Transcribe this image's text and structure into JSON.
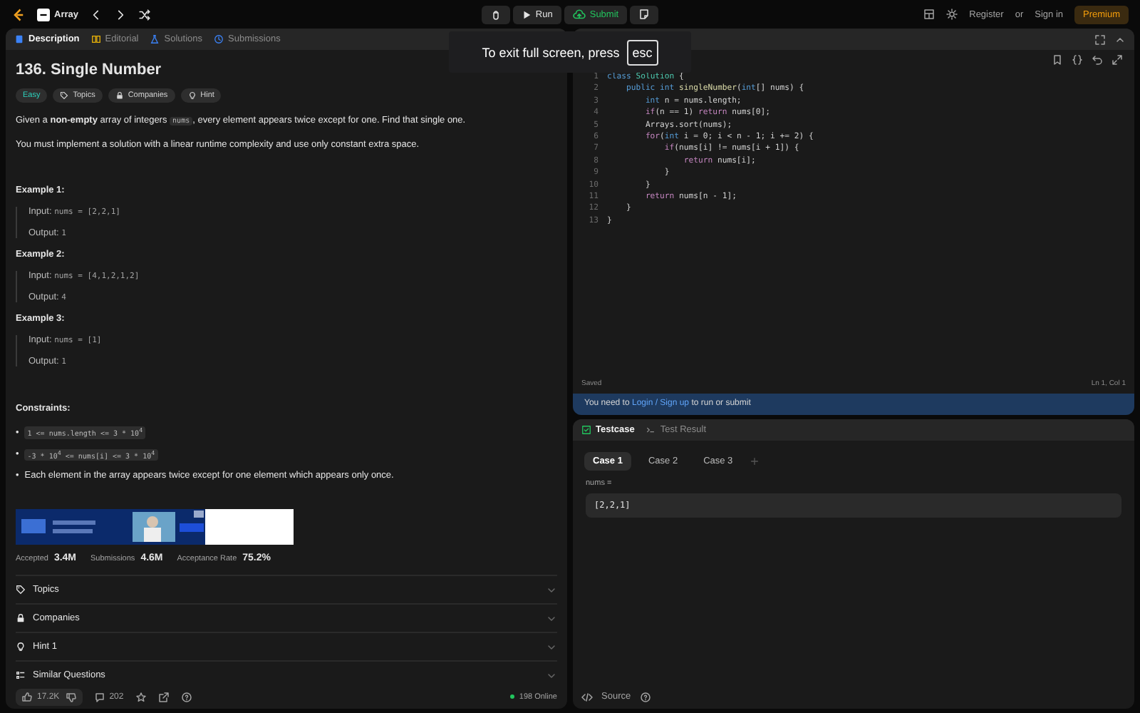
{
  "topbar": {
    "problem_list": "Array",
    "run": "Run",
    "submit": "Submit",
    "register": "Register",
    "or": "or",
    "sign_in": "Sign in",
    "premium": "Premium"
  },
  "left_tabs": [
    {
      "label": "Description",
      "selected": true
    },
    {
      "label": "Editorial",
      "selected": false
    },
    {
      "label": "Solutions",
      "selected": false
    },
    {
      "label": "Submissions",
      "selected": false
    }
  ],
  "problem": {
    "title": "136. Single Number",
    "difficulty": "Easy",
    "tags": [
      {
        "label": "Topics"
      },
      {
        "label": "Companies"
      },
      {
        "label": "Hint"
      }
    ],
    "intro": {
      "before": "Given a **non-empty** array of integers",
      "code": "nums",
      "after": ", every element appears twice except for one. Find that single one."
    },
    "note": "You must implement a solution with a linear runtime complexity and use only constant extra space.",
    "examples": [
      {
        "title": "Example 1:",
        "input_label": "Input:",
        "input": "nums = [2,2,1]",
        "output_label": "Output:",
        "output": "1"
      },
      {
        "title": "Example 2:",
        "input_label": "Input:",
        "input": "nums = [4,1,2,1,2]",
        "output_label": "Output:",
        "output": "4"
      },
      {
        "title": "Example 3:",
        "input_label": "Input:",
        "input": "nums = [1]",
        "output_label": "Output:",
        "output": "1"
      }
    ],
    "constraints_title": "Constraints:",
    "constraints": [
      {
        "kind": "code",
        "bullet": "•",
        "text": "1 <= nums.length <= 3 * 10$^{4}$"
      },
      {
        "kind": "code",
        "bullet": "•",
        "text": "-3 * 10$^{4}$ <= nums[i] <= 3 * 10$^{4}$"
      },
      {
        "kind": "text",
        "bullet": "•",
        "text": "Each element in the array appears twice except for one element which appears only once."
      }
    ],
    "stats": [
      {
        "label": "Accepted",
        "value": "3.4M"
      },
      {
        "label": "Submissions",
        "value": "4.6M"
      },
      {
        "label": "Acceptance Rate",
        "value": "75.2%"
      }
    ],
    "sections": [
      {
        "label": "Topics"
      },
      {
        "label": "Companies"
      },
      {
        "label": "Hint 1"
      },
      {
        "label": "Similar Questions"
      }
    ],
    "footer": {
      "likes": "17.2K",
      "comments": "202",
      "online": "198 Online"
    }
  },
  "code_panel": {
    "saved": "Saved",
    "cursor": "Ln 1, Col 1",
    "lines": [
      [
        {
          "kind": "keyword",
          "t": "class"
        },
        {
          "kind": "type",
          "t": " Solution"
        },
        {
          "kind": "plain",
          "t": " {"
        }
      ],
      [
        {
          "kind": "keyword",
          "t": "    public int"
        },
        {
          "kind": "function",
          "t": " singleNumber"
        },
        {
          "kind": "plain",
          "t": "("
        },
        {
          "kind": "keyword",
          "t": "int"
        },
        {
          "kind": "plain",
          "t": "[] nums) {"
        }
      ],
      [
        {
          "kind": "keyword",
          "t": "        int"
        },
        {
          "kind": "plain",
          "t": " n = nums.length;"
        }
      ],
      [
        {
          "kind": "control",
          "t": "        if"
        },
        {
          "kind": "plain",
          "t": "(n == 1) "
        },
        {
          "kind": "control",
          "t": "return"
        },
        {
          "kind": "plain",
          "t": " nums[0];"
        }
      ],
      [
        {
          "kind": "plain",
          "t": "        Arrays.sort(nums);"
        }
      ],
      [
        {
          "kind": "control",
          "t": "        for"
        },
        {
          "kind": "plain",
          "t": "("
        },
        {
          "kind": "keyword",
          "t": "int"
        },
        {
          "kind": "plain",
          "t": " i = 0; i < n - 1; i += 2) {"
        }
      ],
      [
        {
          "kind": "control",
          "t": "            if"
        },
        {
          "kind": "plain",
          "t": "(nums[i] != nums[i + 1]) {"
        }
      ],
      [
        {
          "kind": "control",
          "t": "                return"
        },
        {
          "kind": "plain",
          "t": " nums[i];"
        }
      ],
      [
        {
          "kind": "plain",
          "t": "            }"
        }
      ],
      [
        {
          "kind": "plain",
          "t": "        }"
        }
      ],
      [
        {
          "kind": "control",
          "t": "        return"
        },
        {
          "kind": "plain",
          "t": " nums[n - 1];"
        }
      ],
      [
        {
          "kind": "plain",
          "t": "    }"
        }
      ],
      [
        {
          "kind": "plain",
          "t": "}"
        }
      ]
    ],
    "line_numbers": [
      "1",
      "2",
      "3",
      "4",
      "5",
      "6",
      "7",
      "8",
      "9",
      "10",
      "11",
      "12",
      "13"
    ],
    "login_notice": {
      "before": "You need to",
      "link": "Login / Sign up",
      "after": "to run or submit"
    }
  },
  "test_tabs": [
    {
      "label": "Testcase",
      "selected": true
    },
    {
      "label": "Test Result",
      "selected": false
    }
  ],
  "cases": [
    {
      "label": "Case 1",
      "selected": true
    },
    {
      "label": "Case 2",
      "selected": false
    },
    {
      "label": "Case 3",
      "selected": false
    }
  ],
  "case_input": {
    "label": "nums =",
    "value": "[2,2,1]"
  },
  "source": "Source",
  "fullscreen_notice": {
    "text": "To exit full screen, press",
    "key": "esc"
  }
}
